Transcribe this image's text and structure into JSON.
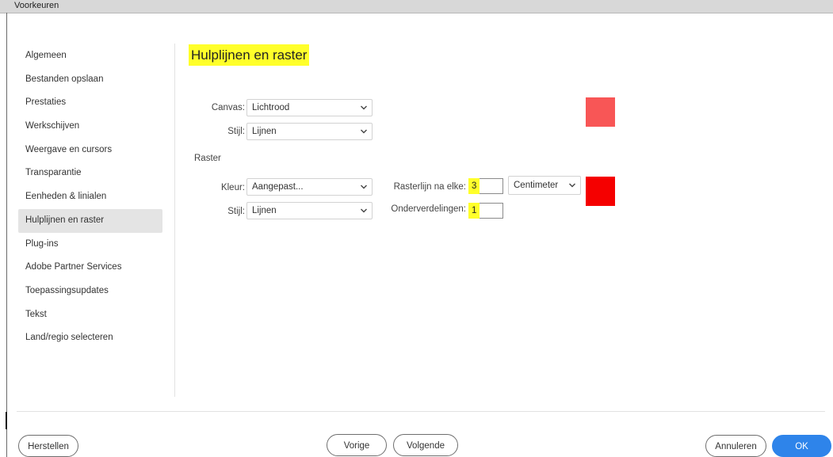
{
  "window": {
    "title": "Voorkeuren"
  },
  "sidebar": {
    "items": [
      {
        "label": "Algemeen"
      },
      {
        "label": "Bestanden opslaan"
      },
      {
        "label": "Prestaties"
      },
      {
        "label": "Werkschijven"
      },
      {
        "label": "Weergave en cursors"
      },
      {
        "label": "Transparantie"
      },
      {
        "label": "Eenheden & linialen"
      },
      {
        "label": "Hulplijnen en raster",
        "selected": true
      },
      {
        "label": "Plug-ins"
      },
      {
        "label": "Adobe Partner Services"
      },
      {
        "label": "Toepassingsupdates"
      },
      {
        "label": "Tekst"
      },
      {
        "label": "Land/regio selecteren"
      }
    ]
  },
  "main": {
    "title": "Hulplijnen en raster",
    "guides": {
      "canvas_label": "Canvas:",
      "canvas_value": "Lichtrood",
      "style_label": "Stijl:",
      "style_value": "Lijnen",
      "swatch_color": "#f85656"
    },
    "grid": {
      "section_label": "Raster",
      "color_label": "Kleur:",
      "color_value": "Aangepast...",
      "style_label": "Stijl:",
      "style_value": "Lijnen",
      "gridline_label": "Rasterlijn na elke:",
      "gridline_value": "3",
      "unit_value": "Centimeter",
      "subdiv_label": "Onderverdelingen:",
      "subdiv_value": "1",
      "swatch_color": "#f50000"
    }
  },
  "footer": {
    "reset_label": "Herstellen",
    "prev_label": "Vorige",
    "next_label": "Volgende",
    "cancel_label": "Annuleren",
    "ok_label": "OK"
  },
  "colors": {
    "highlight": "#ffff2a",
    "primary_button": "#2e84ea"
  }
}
